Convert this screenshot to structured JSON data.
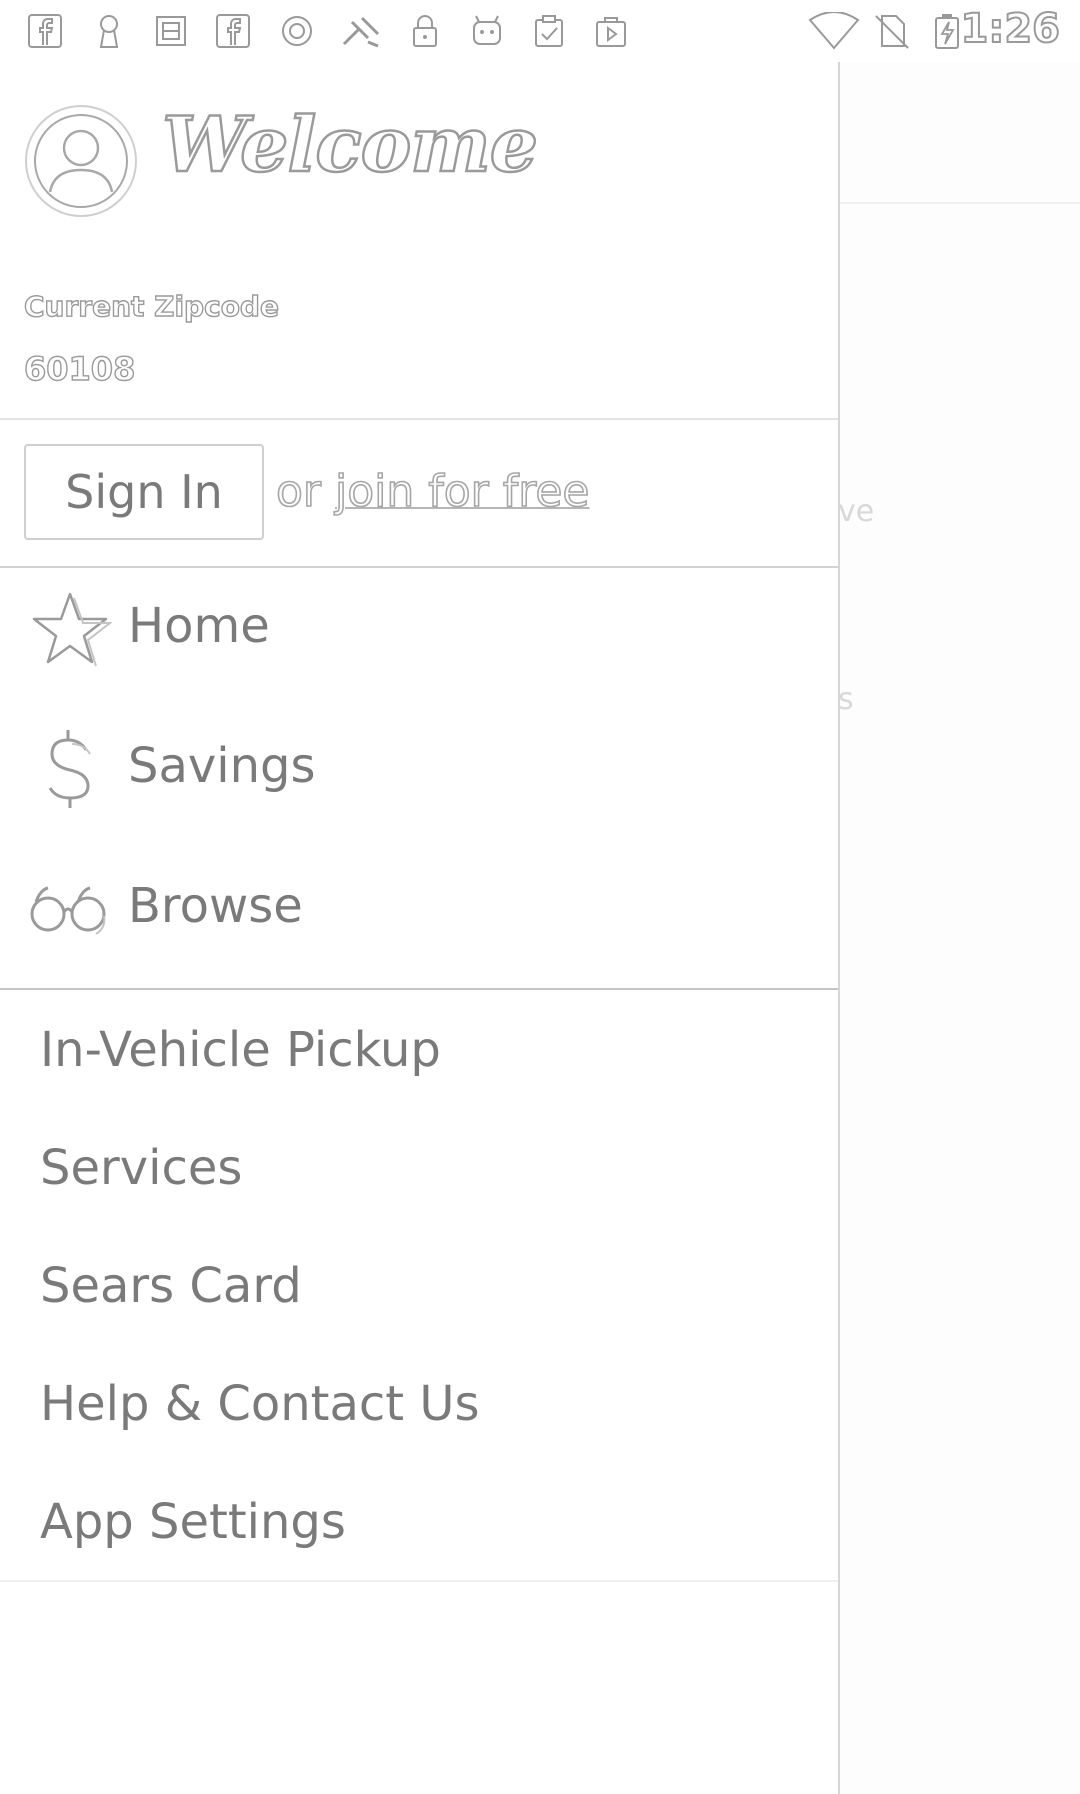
{
  "status_bar": {
    "time": "1:26",
    "icons": [
      "facebook-icon",
      "keyhole-icon",
      "calendar-icon",
      "facebook-icon",
      "circle-icon",
      "fast-tool-icon",
      "lock-icon",
      "android-icon",
      "clipboard-check-icon",
      "play-store-icon",
      "wifi-icon",
      "no-sim-icon",
      "battery-charging-icon"
    ]
  },
  "header": {
    "welcome": "Welcome",
    "zip_label": "Current Zipcode",
    "zip_value": "60108"
  },
  "auth": {
    "sign_in_label": "Sign In",
    "or_text": "or ",
    "join_label": "join for free"
  },
  "primary_nav": [
    {
      "label": "Home",
      "icon": "star-icon"
    },
    {
      "label": "Savings",
      "icon": "dollar-icon"
    },
    {
      "label": "Browse",
      "icon": "glasses-icon"
    }
  ],
  "secondary_nav": [
    {
      "label": "In-Vehicle Pickup"
    },
    {
      "label": "Services"
    },
    {
      "label": "Sears Card"
    },
    {
      "label": "Help & Contact Us"
    },
    {
      "label": "App Settings"
    }
  ],
  "background": {
    "fragment_1": "ve",
    "fragment_2": "s"
  }
}
